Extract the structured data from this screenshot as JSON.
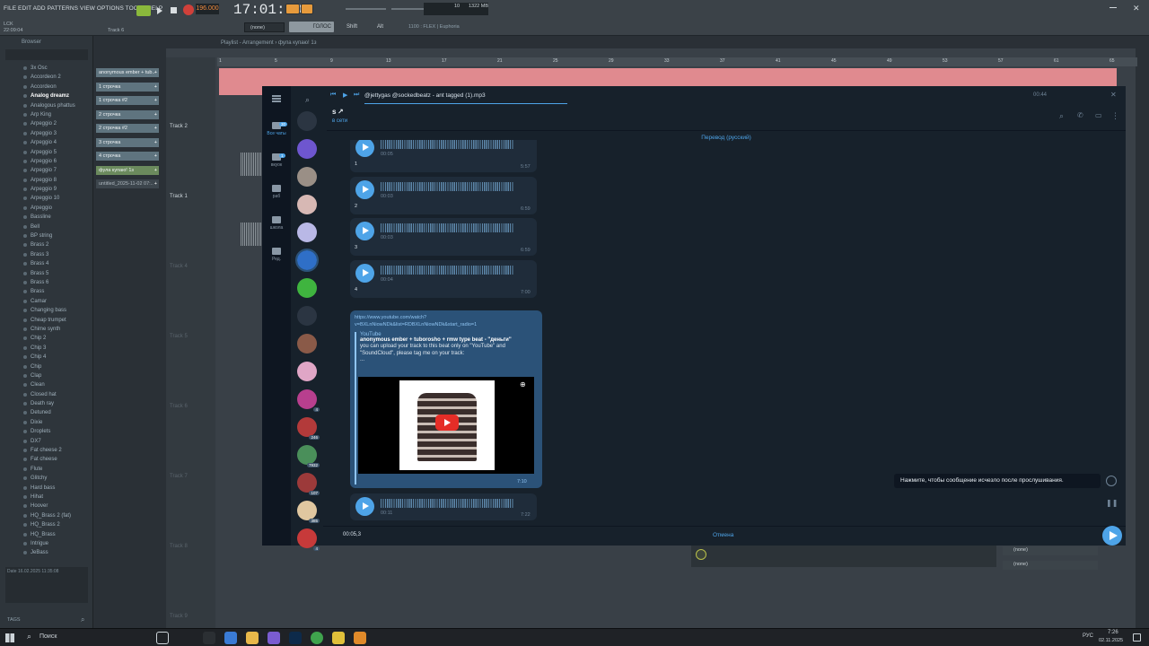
{
  "fl": {
    "menu": "FILE EDIT ADD PATTERNS VIEW OPTIONS TOOLS HELP",
    "bpm": "196.000",
    "clock": "17:01:20",
    "cpu_mem": "1322 MB",
    "cpu_num": "10",
    "pattern_sel": "(none)",
    "mode_label": "ГОЛОС",
    "snap_label": "Shift",
    "tool_label": "Alt",
    "tempo_hint": "1100 : FLEX | Euphoria",
    "hint_a": "Track 6",
    "track_time": "22:09:04",
    "playlist_title": "Playlist - Arrangement › фула купаю! 1з",
    "browser_title": "Browser",
    "browser_items": [
      "3x Osc",
      "Accordeon 2",
      "Accordeon",
      "Analog dreamz",
      "Analogous phattus",
      "Arp King",
      "Arpeggio 2",
      "Arpeggio 3",
      "Arpeggio 4",
      "Arpeggio 5",
      "Arpeggio 6",
      "Arpeggio 7",
      "Arpeggio 8",
      "Arpeggio 9",
      "Arpeggio 10",
      "Arpeggio",
      "Bassline",
      "Bell",
      "BP string",
      "Brass 2",
      "Brass 3",
      "Brass 4",
      "Brass 5",
      "Brass 6",
      "Brass",
      "Camar",
      "Changing bass",
      "Cheap trumpet",
      "Chime synth",
      "Chip 2",
      "Chip 3",
      "Chip 4",
      "Chip",
      "Clap",
      "Clean",
      "Closed hat",
      "Death ray",
      "Detuned",
      "Dixie",
      "Droplets",
      "DX7",
      "Fat cheese 2",
      "Fat cheese",
      "Flute",
      "Glitchy",
      "Hard bass",
      "Hihat",
      "Hoover",
      "HQ_Brass 2 (fat)",
      "HQ_Brass 2",
      "HQ_Brass",
      "Intrigue",
      "JeBass"
    ],
    "browser_selected": 3,
    "browser_info": "Date 16.02.2025 11:35:08",
    "browser_tag": "TAGS",
    "patterns": [
      "anonymous ember + tub..",
      "1 строчка",
      "1 строчка #2",
      "2 строчка",
      "2 строчка #2",
      "3 строчка",
      "4 строчка",
      "фула купаю! 1з",
      "untitled_2025-11-02 07:.."
    ],
    "tracks": [
      "Track 2",
      "Track 1",
      "Track 4",
      "Track 5",
      "Track 6",
      "Track 7",
      "Track 8",
      "Track 9"
    ],
    "ruler_marks": [
      "1",
      "5",
      "9",
      "13",
      "17",
      "21",
      "25",
      "29",
      "33",
      "37",
      "41",
      "45",
      "49",
      "53",
      "57",
      "61",
      "65"
    ],
    "mixer_slots": [
      "(none)",
      "(none)"
    ]
  },
  "tg": {
    "player_title": "@jettygas @sockedbeatz - ant tagged (1).mp3",
    "player_time": "00:44",
    "chat_name": "s ↗",
    "chat_status": "в сети",
    "translate": "Перевод (русский)",
    "folders": [
      "Все чаты",
      "вкуок",
      "раб",
      "школа",
      "Ред."
    ],
    "folder_badges": [
      "30",
      "1"
    ],
    "chat_badges": [
      "4",
      "246",
      "7932",
      "107",
      "385",
      "4"
    ],
    "voice_msgs": [
      {
        "dur": "00:05",
        "num": "1",
        "time": "5:57"
      },
      {
        "dur": "00:03",
        "num": "2",
        "time": "6:59"
      },
      {
        "dur": "00:03",
        "num": "3",
        "time": "6:59"
      },
      {
        "dur": "00:04",
        "num": "4",
        "time": "7:00"
      }
    ],
    "link_url": "https://www.youtube.com/watch?v=BXLnNiowNDk&list=RDBXLnNiowNDk&start_radio=1",
    "yt_site": "YouTube",
    "yt_title": "anonymous ember + tuborosho + rmw type beat - \"деньги\"",
    "yt_desc": "you can upload your track to this beat only on \"YouTube\" and \"SoundCloud\", please tag me on your track:",
    "yt_ellipsis": "...",
    "link_time": "7:10",
    "last_voice": {
      "dur": "00:11",
      "time": "7:22"
    },
    "tooltip": "Нажмите, чтобы сообщение исчезло после прослушивания.",
    "record_time": "00:05,3",
    "cancel": "Отмена",
    "accent": "#4ea4e8"
  },
  "taskbar": {
    "search": "Поиск",
    "lang": "РУС",
    "time": "7:26",
    "date": "02.11.2025"
  }
}
